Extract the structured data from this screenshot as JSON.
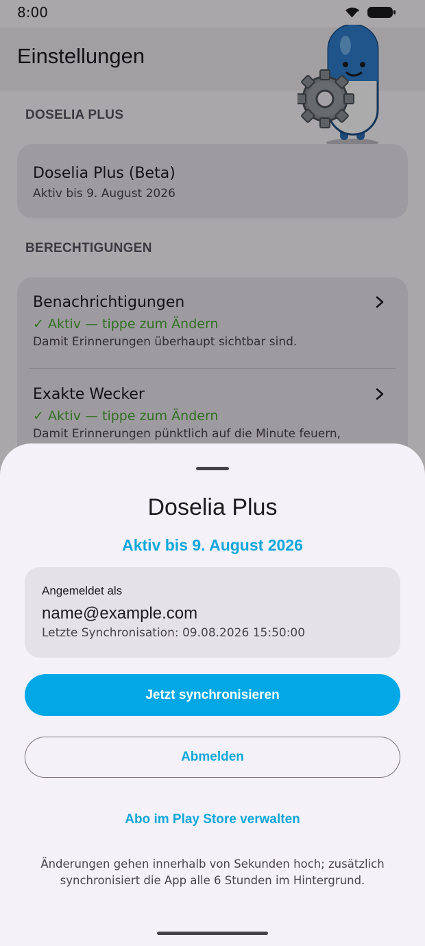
{
  "status_bar": {
    "time": "8:00"
  },
  "app_bar": {
    "title": "Einstellungen"
  },
  "sections": {
    "plus": {
      "header": "DOSELIA PLUS",
      "item": {
        "title": "Doselia Plus (Beta)",
        "subtitle": "Aktiv bis 9. August 2026"
      }
    },
    "permissions": {
      "header": "BERECHTIGUNGEN",
      "items": [
        {
          "title": "Benachrichtigungen",
          "status": "✓ Aktiv — tippe zum Ändern",
          "description": "Damit Erinnerungen überhaupt sichtbar sind."
        },
        {
          "title": "Exakte Wecker",
          "status": "✓ Aktiv — tippe zum Ändern",
          "description": "Damit Erinnerungen pünktlich auf die Minute feuern,"
        }
      ]
    }
  },
  "sheet": {
    "title": "Doselia Plus",
    "subtitle": "Aktiv bis 9. August 2026",
    "account": {
      "label": "Angemeldet als",
      "email": "name@example.com",
      "last_sync": "Letzte Synchronisation: 09.08.2026 15:50:00"
    },
    "sync_button": "Jetzt synchronisieren",
    "logout_button": "Abmelden",
    "manage_link": "Abo im Play Store verwalten",
    "footnote": "Änderungen gehen innerhalb von Sekunden hoch; zusätzlich synchronisiert die App alle 6 Stunden im Hintergrund."
  },
  "colors": {
    "accent": "#02a8e6",
    "accent_text": "#0fa7da",
    "status_ok": "#4aa634",
    "sheet_bg": "#f5f1f9"
  },
  "icons": [
    "wifi-icon",
    "battery-icon",
    "mascot-pill-gear-icon",
    "chevron-right-icon"
  ]
}
